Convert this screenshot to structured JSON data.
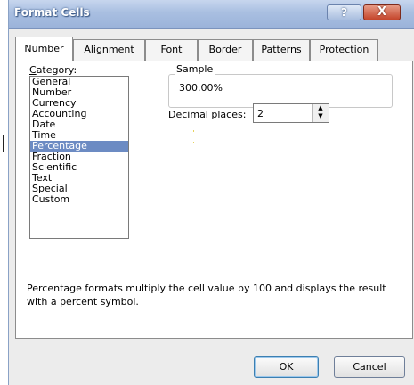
{
  "window": {
    "title": "Format Cells",
    "help_symbol": "?",
    "close_symbol": "X"
  },
  "tabs": [
    {
      "label": "Number",
      "active": true
    },
    {
      "label": "Alignment"
    },
    {
      "label": "Font"
    },
    {
      "label": "Border"
    },
    {
      "label": "Patterns"
    },
    {
      "label": "Protection"
    }
  ],
  "category": {
    "label_underlined": "C",
    "label_rest": "ategory:",
    "items": [
      "General",
      "Number",
      "Currency",
      "Accounting",
      "Date",
      "Time",
      "Percentage",
      "Fraction",
      "Scientific",
      "Text",
      "Special",
      "Custom"
    ],
    "selected": "Percentage"
  },
  "sample": {
    "legend": "Sample",
    "value": "300.00%"
  },
  "decimal_places": {
    "label_underlined": "D",
    "label_rest": "ecimal places:",
    "value": "2"
  },
  "description": "Percentage formats multiply the cell value by 100 and displays the result with a percent symbol.",
  "buttons": {
    "ok": "OK",
    "cancel": "Cancel"
  },
  "icons": {
    "spin_up": "▲",
    "spin_down": "▼"
  }
}
